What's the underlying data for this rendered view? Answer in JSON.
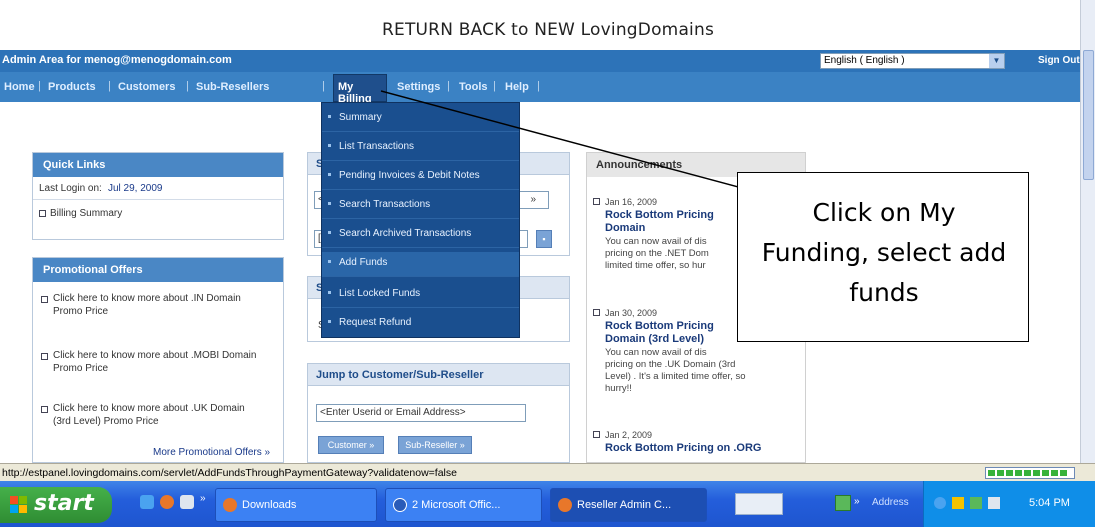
{
  "banner": {
    "text": "RETURN BACK to NEW LovingDomains"
  },
  "admin_bar": {
    "text": "Admin Area for menog@menogdomain.com",
    "language": "English ( English )",
    "sign_out": "Sign Out"
  },
  "nav": {
    "items": [
      "Home",
      "Products",
      "Customers",
      "Sub-Resellers",
      "My Billing",
      "Settings",
      "Tools",
      "Help"
    ],
    "active": "My Billing"
  },
  "dropdown": {
    "items": [
      "Summary",
      "List Transactions",
      "Pending Invoices & Debit Notes",
      "Search Transactions",
      "Search Archived Transactions",
      "Add Funds",
      "List Locked Funds",
      "Request Refund"
    ],
    "highlighted": "Add Funds"
  },
  "quick_links": {
    "title": "Quick Links",
    "last_login_label": "Last Login on:",
    "last_login_date": "Jul 29, 2009",
    "billing_summary": "Billing Summary"
  },
  "promotional": {
    "title": "Promotional Offers",
    "offers": [
      [
        "Click here to know more about .IN Domain",
        "Promo Price"
      ],
      [
        "Click here to know more about .MOBI Domain",
        "Promo Price"
      ],
      [
        "Click here to know more about .UK Domain",
        "(3rd Level) Promo Price"
      ]
    ],
    "more": "More Promotional Offers »"
  },
  "middle": {
    "section1_head": "S",
    "section2_head": "S",
    "section2_text": "S",
    "input1": "<",
    "input2": "[",
    "input1_tail": "»",
    "jump_title": "Jump to Customer/Sub-Reseller",
    "jump_placeholder": "<Enter Userid or Email Address>",
    "customer_btn": "Customer »",
    "subreseller_btn": "Sub-Reseller »"
  },
  "announcements": {
    "title": "Announcements",
    "items": [
      {
        "date": "Jan 16, 2009",
        "title": "Rock Bottom Pricing",
        "title2": "Domain",
        "body": [
          "You can now avail of dis",
          "pricing on the .NET Dom",
          "limited time offer, so hur"
        ]
      },
      {
        "date": "Jan 30, 2009",
        "title": "Rock Bottom Pricing",
        "title2": "Domain (3rd Level)",
        "body": [
          "You can now avail of dis",
          "pricing on the .UK Domain (3rd",
          "Level) . It's a limited time offer, so",
          "hurry!!"
        ]
      },
      {
        "date": "Jan 2, 2009",
        "title": "Rock Bottom Pricing on .ORG",
        "title2": "",
        "body": []
      }
    ]
  },
  "callout": {
    "lines": [
      "Click on My",
      "Funding, select add",
      "funds"
    ]
  },
  "status_bar": {
    "url": "http://estpanel.lovingdomains.com/servlet/AddFundsThroughPaymentGateway?validatenow=false"
  },
  "taskbar": {
    "start": "start",
    "tasks": [
      "Downloads",
      "2 Microsoft Offic...",
      "Reseller Admin C..."
    ],
    "tray_address": "Address",
    "clock": "5:04 PM",
    "ql_chevron": "»",
    "tray_chevron": "»"
  },
  "colors": {
    "nav_blue": "#3b82c4",
    "menu_dark": "#1a4f8f",
    "admin_bar": "#2d73b8",
    "taskbar": "#245edb",
    "start_green": "#2f8d33"
  },
  "icons": [
    "chevron-down-icon",
    "bullet-icon",
    "search-go-icon",
    "windows-logo-icon",
    "ie-icon",
    "firefox-icon",
    "word-icon",
    "network-icon"
  ]
}
